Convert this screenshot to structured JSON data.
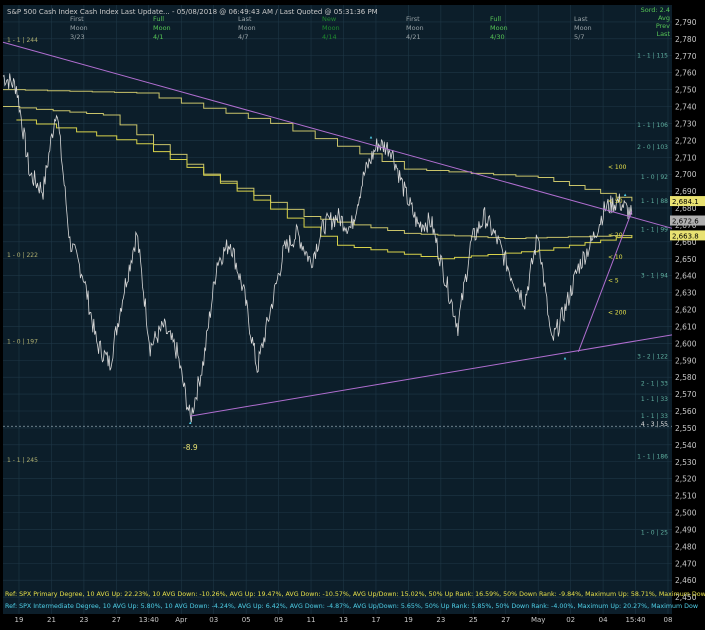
{
  "header": {
    "title": "S&P 500 Cash Index   Cash Index   Last Update... - 05/08/2018 @ 06:49:43 AM / Last Quoted @ 05:31:36 PM",
    "top_right": [
      "Sord: 2.4",
      "Avg",
      "Prev",
      "Last"
    ]
  },
  "moon_phases": [
    {
      "phase": "First",
      "word": "Moon",
      "date": "3/23",
      "color": "#9aa4a8"
    },
    {
      "phase": "Full",
      "word": "Moon",
      "date": "4/1",
      "color": "#56c656"
    },
    {
      "phase": "Last",
      "word": "Moon",
      "date": "4/7",
      "color": "#9aa4a8"
    },
    {
      "phase": "New",
      "word": "Moon",
      "date": "4/14",
      "color": "#1f8a2e"
    },
    {
      "phase": "First",
      "word": "Moon",
      "date": "4/21",
      "color": "#9aa4a8"
    },
    {
      "phase": "Full",
      "word": "Moon",
      "date": "4/30",
      "color": "#56c656"
    },
    {
      "phase": "Last",
      "word": "Moon",
      "date": "5/7",
      "color": "#9aa4a8"
    }
  ],
  "chart_data": {
    "type": "line",
    "title": "S&P 500 Cash Index",
    "ylim": [
      2440,
      2800
    ],
    "y_ticks": [
      2450,
      2460,
      2470,
      2480,
      2490,
      2500,
      2510,
      2520,
      2530,
      2540,
      2550,
      2560,
      2570,
      2580,
      2590,
      2600,
      2610,
      2620,
      2630,
      2640,
      2650,
      2660,
      2670,
      2680,
      2690,
      2700,
      2710,
      2720,
      2730,
      2740,
      2750,
      2760,
      2770,
      2780,
      2790
    ],
    "x_labels": [
      "19",
      "21",
      "23",
      "27",
      "13:40",
      "Apr",
      "03",
      "05",
      "09",
      "11",
      "13",
      "17",
      "19",
      "23",
      "25",
      "27",
      "May",
      "02",
      "04",
      "15:40",
      "08"
    ],
    "price_path": [
      [
        0,
        2758
      ],
      [
        0.02,
        2752
      ],
      [
        0.04,
        2700
      ],
      [
        0.06,
        2690
      ],
      [
        0.08,
        2740
      ],
      [
        0.1,
        2660
      ],
      [
        0.12,
        2640
      ],
      [
        0.14,
        2600
      ],
      [
        0.16,
        2588
      ],
      [
        0.18,
        2630
      ],
      [
        0.2,
        2665
      ],
      [
        0.22,
        2598
      ],
      [
        0.24,
        2610
      ],
      [
        0.26,
        2595
      ],
      [
        0.28,
        2555
      ],
      [
        0.3,
        2590
      ],
      [
        0.32,
        2648
      ],
      [
        0.34,
        2660
      ],
      [
        0.36,
        2630
      ],
      [
        0.38,
        2585
      ],
      [
        0.4,
        2620
      ],
      [
        0.42,
        2655
      ],
      [
        0.44,
        2665
      ],
      [
        0.46,
        2648
      ],
      [
        0.48,
        2670
      ],
      [
        0.5,
        2675
      ],
      [
        0.52,
        2668
      ],
      [
        0.54,
        2700
      ],
      [
        0.56,
        2718
      ],
      [
        0.58,
        2715
      ],
      [
        0.6,
        2690
      ],
      [
        0.62,
        2670
      ],
      [
        0.64,
        2672
      ],
      [
        0.66,
        2640
      ],
      [
        0.68,
        2610
      ],
      [
        0.7,
        2660
      ],
      [
        0.72,
        2675
      ],
      [
        0.74,
        2660
      ],
      [
        0.76,
        2640
      ],
      [
        0.78,
        2625
      ],
      [
        0.8,
        2665
      ],
      [
        0.82,
        2600
      ],
      [
        0.84,
        2620
      ],
      [
        0.86,
        2645
      ],
      [
        0.88,
        2660
      ],
      [
        0.9,
        2680
      ],
      [
        0.92,
        2684
      ],
      [
        0.94,
        2676
      ]
    ],
    "price_color": "#d8d8d8",
    "moving_averages": [
      {
        "label": "< 200",
        "color": "#c9c46a",
        "values": [
          [
            0,
            2750
          ],
          [
            0.2,
            2748
          ],
          [
            0.4,
            2730
          ],
          [
            0.6,
            2703
          ],
          [
            0.8,
            2698
          ],
          [
            0.94,
            2684
          ]
        ]
      },
      {
        "label": "< 100",
        "color": "#c9c46a",
        "values": [
          [
            0,
            2740
          ],
          [
            0.15,
            2735
          ],
          [
            0.3,
            2700
          ],
          [
            0.45,
            2675
          ],
          [
            0.6,
            2665
          ],
          [
            0.75,
            2662
          ],
          [
            0.94,
            2664
          ]
        ]
      },
      {
        "label": "< 50",
        "color": "#d7d24a",
        "values": [
          [
            0.02,
            2732
          ],
          [
            0.2,
            2718
          ],
          [
            0.35,
            2690
          ],
          [
            0.5,
            2658
          ],
          [
            0.65,
            2650
          ],
          [
            0.8,
            2655
          ],
          [
            0.94,
            2664
          ]
        ]
      }
    ],
    "trendlines": [
      {
        "color": "#b06ed0",
        "points": [
          [
            0,
            2778
          ],
          [
            1,
            2668
          ]
        ]
      },
      {
        "color": "#b06ed0",
        "points": [
          [
            0.28,
            2557
          ],
          [
            1,
            2605
          ]
        ]
      },
      {
        "color": "#b06ed0",
        "points": [
          [
            0.86,
            2595
          ],
          [
            0.94,
            2678
          ]
        ]
      }
    ],
    "price_tags": [
      {
        "text": "2,684.1",
        "value": 2684.1,
        "bg": "#e9e272",
        "fg": "#000"
      },
      {
        "text": "2,672.6",
        "value": 2672.6,
        "bg": "#b0b0b0",
        "fg": "#000"
      },
      {
        "text": "2,663.8",
        "value": 2663.8,
        "bg": "#e9e272",
        "fg": "#000"
      }
    ],
    "annotations": [
      {
        "text": "-8.9",
        "x": 0.28,
        "value": 2537,
        "color": "#e9e272"
      }
    ],
    "ma_markers": [
      {
        "text": "< 100",
        "value": 2703
      },
      {
        "text": "< 50",
        "value": 2683
      },
      {
        "text": "< 20",
        "value": 2663
      },
      {
        "text": "< 10",
        "value": 2650
      },
      {
        "text": "< 5",
        "value": 2636
      },
      {
        "text": "< 200",
        "value": 2617
      }
    ],
    "gann_levels": [
      {
        "text": "1 - 1 | 244",
        "value": 2778,
        "side": "left",
        "color": "#b0b070"
      },
      {
        "text": "1 - 0 | 222",
        "value": 2651,
        "side": "left",
        "color": "#b0b070"
      },
      {
        "text": "1 - 0 | 197",
        "value": 2600,
        "side": "left",
        "color": "#b0b070"
      },
      {
        "text": "1 - 1 | 245",
        "value": 2530,
        "side": "left",
        "color": "#b0b070"
      },
      {
        "text": "1 - 1 | 115",
        "value": 2769,
        "side": "right",
        "color": "#5fb0a0"
      },
      {
        "text": "1 - 1 | 106",
        "value": 2728,
        "side": "right",
        "color": "#5fb0a0"
      },
      {
        "text": "2 - 0 | 103",
        "value": 2715,
        "side": "right",
        "color": "#5fb0a0"
      },
      {
        "text": "1 - 0 | 92",
        "value": 2697,
        "side": "right",
        "color": "#5fb0a0"
      },
      {
        "text": "1 - 1 | 88",
        "value": 2683,
        "side": "right",
        "color": "#5fb0a0"
      },
      {
        "text": "1 - 1 | 99",
        "value": 2666,
        "side": "right",
        "color": "#5fb0a0"
      },
      {
        "text": "3 - 1 | 94",
        "value": 2639,
        "side": "right",
        "color": "#5fb0a0"
      },
      {
        "text": "3 - 2 | 122",
        "value": 2591,
        "side": "right",
        "color": "#5fb0a0"
      },
      {
        "text": "2 - 1 | 33",
        "value": 2575,
        "side": "right",
        "color": "#5fb0a0"
      },
      {
        "text": "1 - 1 | 33",
        "value": 2566,
        "side": "right",
        "color": "#5fb0a0"
      },
      {
        "text": "1 - 1 | 33",
        "value": 2556,
        "side": "right",
        "color": "#5fb0a0"
      },
      {
        "text": "4 - 3 | 55",
        "value": 2551,
        "side": "right",
        "color": "#e0e0e0"
      },
      {
        "text": "1 - 1 | 186",
        "value": 2532,
        "side": "right",
        "color": "#5fb0a0"
      },
      {
        "text": "1 - 0 | 25",
        "value": 2487,
        "side": "right",
        "color": "#5fb0a0"
      }
    ],
    "dashed_levels": [
      2551
    ],
    "footer_lines": [
      {
        "text": "Ref: SPX Primary Degree, 10 AVG Up: 22.23%, 10 AVG Down: -10.26%, AVG Up: 19.47%, AVG Down: -10.57%, AVG Up/Down: 15.02%, 50%  Up Rank: 16.59%, 50% Down Rank: -9.84%, Maximum Up: 58.71%, Maximum Down: -",
        "color": "#e6e04a"
      },
      {
        "text": "Ref: SPX Intermediate Degree, 10 AVG Up: 5.80%, 10 AVG Down: -4.24%, AVG Up: 6.42%, AVG Down: -4.87%, AVG Up/Down: 5.65%, 50%  Up Rank: 5.85%, 50% Down Rank: -4.00%, Maximum Up: 20.27%, Maximum Dow",
        "color": "#4fd0e8"
      }
    ],
    "grid": true
  },
  "colors": {
    "background": "#0c1e2a",
    "grid": "#1e3746",
    "axis_text": "#c8c8c8"
  }
}
